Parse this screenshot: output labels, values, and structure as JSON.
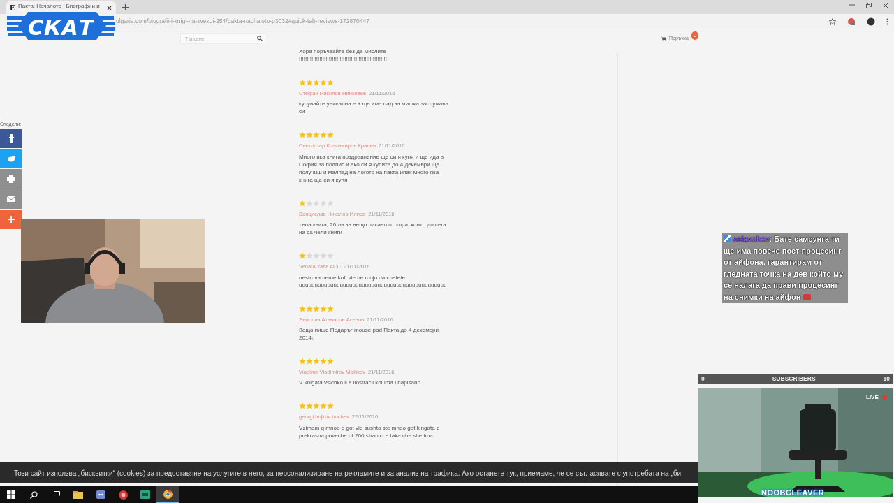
{
  "browser": {
    "favicon": "E",
    "tab_title": "Пакта: Началото | Биографии и",
    "url": "ulgaria.com/biografii-i-knigi-na-zvezdi-254/pakta-nachaloto-p3032#quick-tab-reviews-172870447"
  },
  "header": {
    "search": {
      "placeholder": "Търсене"
    },
    "cart": {
      "label": "Поръчка",
      "count": "0"
    }
  },
  "share": {
    "label": "Сподели:",
    "buttons": [
      {
        "kind": "facebook",
        "color": "#3b5998"
      },
      {
        "kind": "twitter",
        "color": "#1da1f2"
      },
      {
        "kind": "print",
        "color": "#8f8f8f"
      },
      {
        "kind": "email",
        "color": "#8f8f8f"
      },
      {
        "kind": "more",
        "color": "#f0643c"
      }
    ]
  },
  "reviews": [
    {
      "text": "Хора поръчвайте без да мислите !!!!!!!!!!!!!!!!!!!!!!!!!!!!!!!!!!!!!!!!!!!!!!!!!!!!!!!!"
    },
    {
      "stars": 5,
      "author": "Стефан Николов Николаев",
      "date": "21/11/2016",
      "text": "купувайте уникална е + ще има пад за мишка заслужава си"
    },
    {
      "stars": 5,
      "author": "Светлозар Красимиров Кралев",
      "date": "21/11/2016",
      "text": "Много яка книга поздравление ще си я купя и ще ида в София за подпис и ако си я купите до 4 декември ще получиш и малпад на логото на пакта ипак много яка книга ще си я купя"
    },
    {
      "stars": 1,
      "author": "Венцислав Николов Илиев",
      "date": "21/11/2016",
      "text": "тъпа книга, 20 лв за нещо писано от хора, които до сега на са чели книги"
    },
    {
      "stars": 1,
      "author": "Venata Yase ACC",
      "date": "21/11/2016",
      "text": "nestruva neme kofi vie ne mojo da cnetete uuuuuuuuuuuuuuuuuuuuuuuuuuuuuuuuuuuuuuuuuuuuuuu"
    },
    {
      "stars": 5,
      "author": "Янислав Атанасов Асенов",
      "date": "21/11/2016",
      "text": "Защо пише Подаръг mouse pad Пакта до 4 декември 2014г."
    },
    {
      "stars": 5,
      "author": "Vladimir Vladimirov Mishkov",
      "date": "21/11/2016",
      "text": "V knigata vsichko li e ilostracii koi ima i napisano"
    },
    {
      "stars": 5,
      "author": "georgi bojkov bochev",
      "date": "22/11/2016",
      "text": "Vzimam q mnoo e got vie sushto ste mnoo got kingata e prekrasna poveche ot 200 stranici e taka che she ima"
    }
  ],
  "cookie_notice": "Този сайт използва „бисквитки“ (cookies) за предоставяне на услугите в него, за персонализиране на рекламите и за анализ на трафика. Ако останете тук, приемаме, че се съгласявате с употребата на „би",
  "stream": {
    "logo": "СКАТ",
    "chat": {
      "username": "sslavchev",
      "message": ": Бате самсунга ти ще има повече пост процесинг от айфона, гарантирам от гледната точка на дев който му се налага да прави процесинг на снимки на айфон"
    },
    "subscribers": {
      "current": "0",
      "label": "SUBSCRIBERS",
      "goal": "10"
    },
    "live": "LIVE",
    "streamer": "NOOBCLEAVER"
  }
}
